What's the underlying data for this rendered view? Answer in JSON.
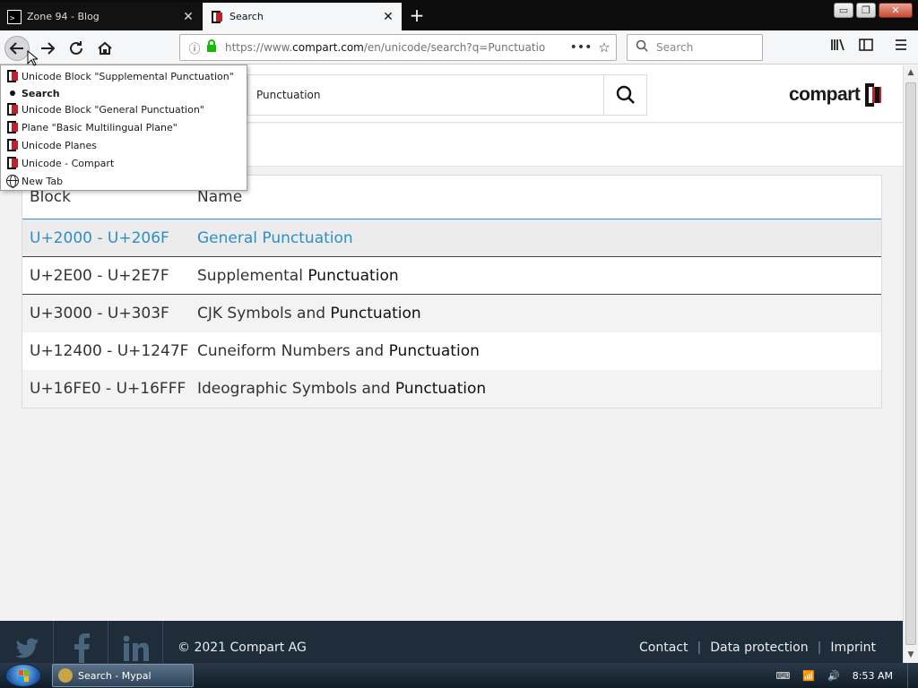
{
  "browser": {
    "tabs": [
      {
        "title": "Zone 94 - Blog",
        "active": false
      },
      {
        "title": "Search",
        "active": true
      }
    ],
    "window_controls": {
      "minimize": "▭",
      "maximize": "❐",
      "close": "✕"
    },
    "url_prefix": "https://www.",
    "url_host": "compart.com",
    "url_path": "/en/unicode/search?q=Punctuatio",
    "search_placeholder": "Search"
  },
  "history_menu": [
    {
      "label": "Unicode Block \"Supplemental Punctuation\"",
      "icon": "compart-favicon",
      "current": false
    },
    {
      "label": "Search",
      "icon": "current-dot",
      "current": true
    },
    {
      "label": "Unicode Block \"General Punctuation\"",
      "icon": "compart-favicon",
      "current": false
    },
    {
      "label": "Plane \"Basic Multilingual Plane\"",
      "icon": "compart-favicon",
      "current": false
    },
    {
      "label": "Unicode Planes",
      "icon": "compart-favicon",
      "current": false
    },
    {
      "label": "Unicode - Compart",
      "icon": "compart-favicon",
      "current": false
    },
    {
      "label": "New Tab",
      "icon": "globe-icon",
      "current": false
    }
  ],
  "site": {
    "search_value": "Punctuation",
    "logo_text": "compart"
  },
  "results": {
    "headers": {
      "block": "Block",
      "name": "Name"
    },
    "rows": [
      {
        "block": "U+2000 - U+206F",
        "name_prefix": "General ",
        "name_match": "Punctuation"
      },
      {
        "block": "U+2E00 - U+2E7F",
        "name_prefix": "Supplemental ",
        "name_match": "Punctuation"
      },
      {
        "block": "U+3000 - U+303F",
        "name_prefix": "CJK Symbols and ",
        "name_match": "Punctuation"
      },
      {
        "block": "U+12400 - U+1247F",
        "name_prefix": "Cuneiform Numbers and ",
        "name_match": "Punctuation"
      },
      {
        "block": "U+16FE0 - U+16FFF",
        "name_prefix": "Ideographic Symbols and ",
        "name_match": "Punctuation"
      }
    ]
  },
  "footer": {
    "copyright": "© 2021 Compart AG",
    "links": [
      "Contact",
      "Data protection",
      "Imprint"
    ],
    "separator": "|"
  },
  "taskbar": {
    "item": "Search - Mypal",
    "clock": "8:53 AM"
  },
  "colors": {
    "accent_link": "#2d8fc7",
    "footer_bg": "#1f2d3a",
    "logo_red": "#c0202a"
  }
}
